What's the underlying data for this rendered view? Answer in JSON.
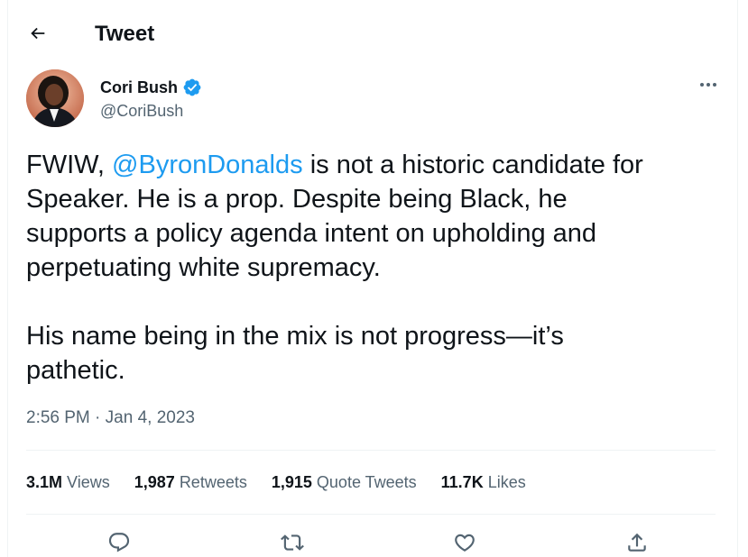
{
  "header": {
    "title": "Tweet"
  },
  "author": {
    "display_name": "Cori Bush",
    "handle": "@CoriBush",
    "verified_color": "#1d9bf0"
  },
  "tweet": {
    "text_before_mention": "FWIW, ",
    "mention": "@ByronDonalds",
    "text_after_mention": " is not a historic candidate for\nSpeaker. He is a prop. Despite being Black, he\nsupports a policy agenda intent on upholding and\nperpetuating white supremacy.\n\nHis name being in the mix is not progress—it’s\npathetic.",
    "time": "2:56 PM",
    "separator": " · ",
    "date": "Jan 4, 2023"
  },
  "stats": [
    {
      "value": "3.1M",
      "label": "Views"
    },
    {
      "value": "1,987",
      "label": "Retweets"
    },
    {
      "value": "1,915",
      "label": "Quote Tweets"
    },
    {
      "value": "11.7K",
      "label": "Likes"
    }
  ],
  "icons": {
    "back": "arrow-left-icon",
    "more": "more-horizontal-icon",
    "reply": "reply-icon",
    "retweet": "retweet-icon",
    "like": "heart-icon",
    "share": "share-icon"
  },
  "colors": {
    "accent": "#1d9bf0",
    "text": "#0f1419",
    "secondary": "#536471",
    "border": "#eff3f4"
  }
}
